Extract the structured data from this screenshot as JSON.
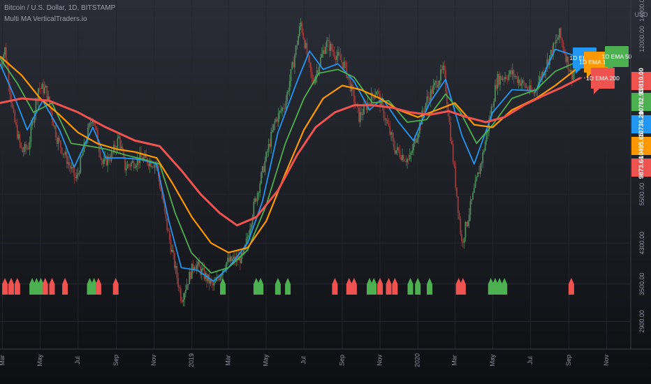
{
  "header": {
    "symbol_line": "Bitcoin / U.S. Dollar, 1D, BITSTAMP",
    "indicator_line": "Multi MA VerticalTraders.io"
  },
  "currency_label": "USD",
  "colors": {
    "ema20": "#2196f3",
    "ema50": "#4caf50",
    "ema100": "#ff9800",
    "ema200": "#ef5350",
    "candle_up": "#4d8a5c",
    "candle_down": "#9a3b3b",
    "signal_buy": "#4caf50",
    "signal_sell": "#ef5350"
  },
  "chart_data": {
    "type": "line",
    "title": "Bitcoin / U.S. Dollar, 1D, BITSTAMP",
    "y_scale": "log",
    "ylim": [
      2650,
      14300
    ],
    "x_range": [
      "2018-02-25",
      "2020-12-10"
    ],
    "y_ticks": [
      "14000.00",
      "12000.00",
      "8000.00",
      "5500.00",
      "4300.00",
      "3500.00",
      "2900.00"
    ],
    "x_ticks": [
      {
        "date": "2018-03-01",
        "label": "Mar"
      },
      {
        "date": "2018-05-01",
        "label": "May"
      },
      {
        "date": "2018-07-01",
        "label": "Jul"
      },
      {
        "date": "2018-09-01",
        "label": "Sep"
      },
      {
        "date": "2018-11-01",
        "label": "Nov"
      },
      {
        "date": "2019-01-01",
        "label": "2019"
      },
      {
        "date": "2019-03-01",
        "label": "Mar"
      },
      {
        "date": "2019-05-01",
        "label": "May"
      },
      {
        "date": "2019-07-01",
        "label": "Jul"
      },
      {
        "date": "2019-09-01",
        "label": "Sep"
      },
      {
        "date": "2019-11-01",
        "label": "Nov"
      },
      {
        "date": "2020-01-01",
        "label": "2020"
      },
      {
        "date": "2020-03-01",
        "label": "Mar"
      },
      {
        "date": "2020-05-01",
        "label": "May"
      },
      {
        "date": "2020-07-01",
        "label": "Jul"
      },
      {
        "date": "2020-09-01",
        "label": "Sep"
      },
      {
        "date": "2020-11-01",
        "label": "Nov"
      }
    ],
    "price_labels": [
      {
        "value": 11000,
        "text": "10810.00",
        "color": "#ef5350"
      },
      {
        "value": 10782.93,
        "text": "10782.93",
        "color": "#4caf50"
      },
      {
        "value": 10736.2,
        "text": "10736.20",
        "color": "#2196f3"
      },
      {
        "value": 10495.65,
        "text": "10495.65",
        "color": "#ff9800"
      },
      {
        "value": 9873.64,
        "text": "9873.64",
        "color": "#ef5350"
      }
    ],
    "legend_flags": [
      {
        "text": "1D EMA 20",
        "color": "#2196f3"
      },
      {
        "text": "1D EMA 100",
        "color": "#ff9800"
      },
      {
        "text": "1D EMA 50",
        "color": "#4caf50"
      },
      {
        "text": "1D EMA 200",
        "color": "#ef5350"
      }
    ],
    "series": [
      {
        "name": "1D EMA 20",
        "color": "#2196f3",
        "points": [
          [
            "2018-02-25",
            10600
          ],
          [
            "2018-03-20",
            9000
          ],
          [
            "2018-04-10",
            7600
          ],
          [
            "2018-05-05",
            8800
          ],
          [
            "2018-06-01",
            7600
          ],
          [
            "2018-06-25",
            6300
          ],
          [
            "2018-07-25",
            7700
          ],
          [
            "2018-08-15",
            6600
          ],
          [
            "2018-09-10",
            6600
          ],
          [
            "2018-10-10",
            6550
          ],
          [
            "2018-11-05",
            6400
          ],
          [
            "2018-11-25",
            4800
          ],
          [
            "2018-12-15",
            3800
          ],
          [
            "2019-01-10",
            3750
          ],
          [
            "2019-02-05",
            3550
          ],
          [
            "2019-03-01",
            3800
          ],
          [
            "2019-04-01",
            4300
          ],
          [
            "2019-04-25",
            5300
          ],
          [
            "2019-05-20",
            7500
          ],
          [
            "2019-06-20",
            9700
          ],
          [
            "2019-07-10",
            11300
          ],
          [
            "2019-08-01",
            10300
          ],
          [
            "2019-08-25",
            10600
          ],
          [
            "2019-09-20",
            9700
          ],
          [
            "2019-10-15",
            8400
          ],
          [
            "2019-11-05",
            8900
          ],
          [
            "2019-12-01",
            7900
          ],
          [
            "2019-12-25",
            7200
          ],
          [
            "2020-01-20",
            8700
          ],
          [
            "2020-02-15",
            9800
          ],
          [
            "2020-03-12",
            7400
          ],
          [
            "2020-04-01",
            6400
          ],
          [
            "2020-05-01",
            8300
          ],
          [
            "2020-06-01",
            9300
          ],
          [
            "2020-07-10",
            9250
          ],
          [
            "2020-08-10",
            11400
          ],
          [
            "2020-09-05",
            11100
          ],
          [
            "2020-09-20",
            10736
          ]
        ]
      },
      {
        "name": "1D EMA 50",
        "color": "#4caf50",
        "points": [
          [
            "2018-02-25",
            10900
          ],
          [
            "2018-03-25",
            9600
          ],
          [
            "2018-04-20",
            8300
          ],
          [
            "2018-05-20",
            8700
          ],
          [
            "2018-06-20",
            7100
          ],
          [
            "2018-07-20",
            7000
          ],
          [
            "2018-08-15",
            6900
          ],
          [
            "2018-09-15",
            6700
          ],
          [
            "2018-10-15",
            6550
          ],
          [
            "2018-11-10",
            6400
          ],
          [
            "2018-12-05",
            5000
          ],
          [
            "2018-12-31",
            4100
          ],
          [
            "2019-02-01",
            3700
          ],
          [
            "2019-03-01",
            3800
          ],
          [
            "2019-04-01",
            4150
          ],
          [
            "2019-05-01",
            5200
          ],
          [
            "2019-06-01",
            7100
          ],
          [
            "2019-07-01",
            8900
          ],
          [
            "2019-07-25",
            10100
          ],
          [
            "2019-08-25",
            10300
          ],
          [
            "2019-09-20",
            9900
          ],
          [
            "2019-10-20",
            8700
          ],
          [
            "2019-11-15",
            8800
          ],
          [
            "2019-12-15",
            7900
          ],
          [
            "2020-01-15",
            8000
          ],
          [
            "2020-02-15",
            9100
          ],
          [
            "2020-03-10",
            8300
          ],
          [
            "2020-04-05",
            7100
          ],
          [
            "2020-05-01",
            7800
          ],
          [
            "2020-06-01",
            8900
          ],
          [
            "2020-07-10",
            9300
          ],
          [
            "2020-08-10",
            10200
          ],
          [
            "2020-09-20",
            10783
          ]
        ]
      },
      {
        "name": "1D EMA 100",
        "color": "#ff9800",
        "points": [
          [
            "2018-02-25",
            11000
          ],
          [
            "2018-04-01",
            10000
          ],
          [
            "2018-05-01",
            8900
          ],
          [
            "2018-06-01",
            8200
          ],
          [
            "2018-07-01",
            7500
          ],
          [
            "2018-08-01",
            7100
          ],
          [
            "2018-09-01",
            6900
          ],
          [
            "2018-10-01",
            6800
          ],
          [
            "2018-11-05",
            6600
          ],
          [
            "2018-12-01",
            5800
          ],
          [
            "2019-01-01",
            4900
          ],
          [
            "2019-02-01",
            4300
          ],
          [
            "2019-03-01",
            4100
          ],
          [
            "2019-04-01",
            4200
          ],
          [
            "2019-05-01",
            4800
          ],
          [
            "2019-06-01",
            6100
          ],
          [
            "2019-07-01",
            7600
          ],
          [
            "2019-08-01",
            8900
          ],
          [
            "2019-09-01",
            9500
          ],
          [
            "2019-10-01",
            9300
          ],
          [
            "2019-11-01",
            8900
          ],
          [
            "2019-12-01",
            8400
          ],
          [
            "2020-01-01",
            8100
          ],
          [
            "2020-02-01",
            8400
          ],
          [
            "2020-03-01",
            8700
          ],
          [
            "2020-04-01",
            7800
          ],
          [
            "2020-05-01",
            7700
          ],
          [
            "2020-06-01",
            8400
          ],
          [
            "2020-07-10",
            8900
          ],
          [
            "2020-08-10",
            9500
          ],
          [
            "2020-09-20",
            10496
          ]
        ]
      },
      {
        "name": "1D EMA 200",
        "color": "#ef5350",
        "points": [
          [
            "2018-02-25",
            8700
          ],
          [
            "2018-04-01",
            8900
          ],
          [
            "2018-05-15",
            8800
          ],
          [
            "2018-07-01",
            8300
          ],
          [
            "2018-08-15",
            7700
          ],
          [
            "2018-10-01",
            7200
          ],
          [
            "2018-11-10",
            7000
          ],
          [
            "2018-12-15",
            6200
          ],
          [
            "2019-01-15",
            5500
          ],
          [
            "2019-02-15",
            5000
          ],
          [
            "2019-03-15",
            4700
          ],
          [
            "2019-04-15",
            4900
          ],
          [
            "2019-05-20",
            5600
          ],
          [
            "2019-06-20",
            6700
          ],
          [
            "2019-07-20",
            7700
          ],
          [
            "2019-08-20",
            8300
          ],
          [
            "2019-09-20",
            8600
          ],
          [
            "2019-10-20",
            8600
          ],
          [
            "2019-11-20",
            8500
          ],
          [
            "2019-12-20",
            8300
          ],
          [
            "2020-01-20",
            8200
          ],
          [
            "2020-02-20",
            8350
          ],
          [
            "2020-03-20",
            8100
          ],
          [
            "2020-04-20",
            7900
          ],
          [
            "2020-05-20",
            8100
          ],
          [
            "2020-06-20",
            8600
          ],
          [
            "2020-07-20",
            9000
          ],
          [
            "2020-08-20",
            9400
          ],
          [
            "2020-09-20",
            9874
          ]
        ]
      }
    ],
    "price_trace": [
      [
        "2018-02-25",
        10500
      ],
      [
        "2018-03-05",
        11400
      ],
      [
        "2018-03-18",
        8200
      ],
      [
        "2018-04-01",
        6800
      ],
      [
        "2018-04-12",
        7000
      ],
      [
        "2018-04-28",
        9400
      ],
      [
        "2018-05-10",
        9300
      ],
      [
        "2018-05-28",
        7300
      ],
      [
        "2018-06-12",
        6600
      ],
      [
        "2018-06-28",
        5900
      ],
      [
        "2018-07-24",
        8200
      ],
      [
        "2018-08-10",
        6400
      ],
      [
        "2018-08-25",
        6700
      ],
      [
        "2018-09-05",
        7300
      ],
      [
        "2018-09-15",
        6300
      ],
      [
        "2018-10-10",
        6600
      ],
      [
        "2018-11-05",
        6400
      ],
      [
        "2018-11-20",
        4800
      ],
      [
        "2018-12-15",
        3250
      ],
      [
        "2019-01-05",
        3900
      ],
      [
        "2019-02-05",
        3450
      ],
      [
        "2019-02-25",
        3900
      ],
      [
        "2019-03-25",
        4000
      ],
      [
        "2019-04-10",
        5100
      ],
      [
        "2019-05-15",
        7900
      ],
      [
        "2019-06-01",
        8700
      ],
      [
        "2019-06-26",
        13000
      ],
      [
        "2019-07-15",
        9600
      ],
      [
        "2019-08-06",
        11800
      ],
      [
        "2019-09-05",
        10500
      ],
      [
        "2019-09-28",
        8100
      ],
      [
        "2019-10-26",
        9300
      ],
      [
        "2019-11-25",
        6900
      ],
      [
        "2019-12-18",
        6500
      ],
      [
        "2020-01-15",
        8800
      ],
      [
        "2020-02-12",
        10300
      ],
      [
        "2020-03-12",
        4300
      ],
      [
        "2020-04-15",
        6700
      ],
      [
        "2020-05-08",
        9800
      ],
      [
        "2020-06-01",
        10100
      ],
      [
        "2020-07-05",
        9100
      ],
      [
        "2020-08-17",
        12300
      ],
      [
        "2020-09-05",
        10000
      ],
      [
        "2020-09-20",
        10900
      ]
    ],
    "signals": [
      {
        "date": "2018-03-05",
        "type": "sell"
      },
      {
        "date": "2018-03-15",
        "type": "sell"
      },
      {
        "date": "2018-03-25",
        "type": "sell"
      },
      {
        "date": "2018-04-18",
        "type": "buy"
      },
      {
        "date": "2018-04-25",
        "type": "buy"
      },
      {
        "date": "2018-05-02",
        "type": "buy"
      },
      {
        "date": "2018-05-09",
        "type": "sell"
      },
      {
        "date": "2018-05-20",
        "type": "sell"
      },
      {
        "date": "2018-06-10",
        "type": "sell"
      },
      {
        "date": "2018-07-20",
        "type": "buy"
      },
      {
        "date": "2018-07-27",
        "type": "buy"
      },
      {
        "date": "2018-08-03",
        "type": "sell"
      },
      {
        "date": "2018-08-31",
        "type": "sell"
      },
      {
        "date": "2019-02-20",
        "type": "buy"
      },
      {
        "date": "2019-04-15",
        "type": "buy"
      },
      {
        "date": "2019-04-22",
        "type": "buy"
      },
      {
        "date": "2019-05-20",
        "type": "buy"
      },
      {
        "date": "2019-06-05",
        "type": "buy"
      },
      {
        "date": "2019-08-20",
        "type": "sell"
      },
      {
        "date": "2019-09-12",
        "type": "sell"
      },
      {
        "date": "2019-09-20",
        "type": "sell"
      },
      {
        "date": "2019-10-15",
        "type": "buy"
      },
      {
        "date": "2019-10-22",
        "type": "buy"
      },
      {
        "date": "2019-11-01",
        "type": "sell"
      },
      {
        "date": "2019-11-15",
        "type": "sell"
      },
      {
        "date": "2019-11-25",
        "type": "sell"
      },
      {
        "date": "2019-12-20",
        "type": "buy"
      },
      {
        "date": "2020-01-01",
        "type": "buy"
      },
      {
        "date": "2020-01-20",
        "type": "buy"
      },
      {
        "date": "2020-03-07",
        "type": "sell"
      },
      {
        "date": "2020-03-14",
        "type": "sell"
      },
      {
        "date": "2020-04-28",
        "type": "buy"
      },
      {
        "date": "2020-05-05",
        "type": "buy"
      },
      {
        "date": "2020-05-12",
        "type": "buy"
      },
      {
        "date": "2020-05-20",
        "type": "buy"
      },
      {
        "date": "2020-09-05",
        "type": "sell"
      }
    ]
  }
}
